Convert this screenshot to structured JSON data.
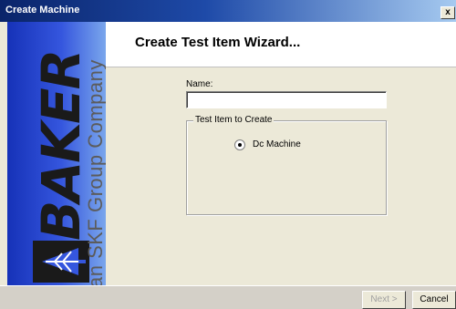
{
  "window": {
    "title": "Create Machine",
    "close_glyph": "x"
  },
  "brand": {
    "wordmark": "BAKER",
    "tagline": "an SKF Group Company",
    "colors": {
      "panel_start": "#1632b8",
      "panel_end": "#7aa6ec"
    }
  },
  "header": {
    "title": "Create Test Item Wizard..."
  },
  "form": {
    "name_label": "Name:",
    "name_value": "",
    "group_title": "Test Item to Create",
    "options": [
      {
        "label": "Dc Machine",
        "selected": true
      }
    ]
  },
  "buttons": {
    "next_label": "Next >",
    "cancel_label": "Cancel"
  }
}
